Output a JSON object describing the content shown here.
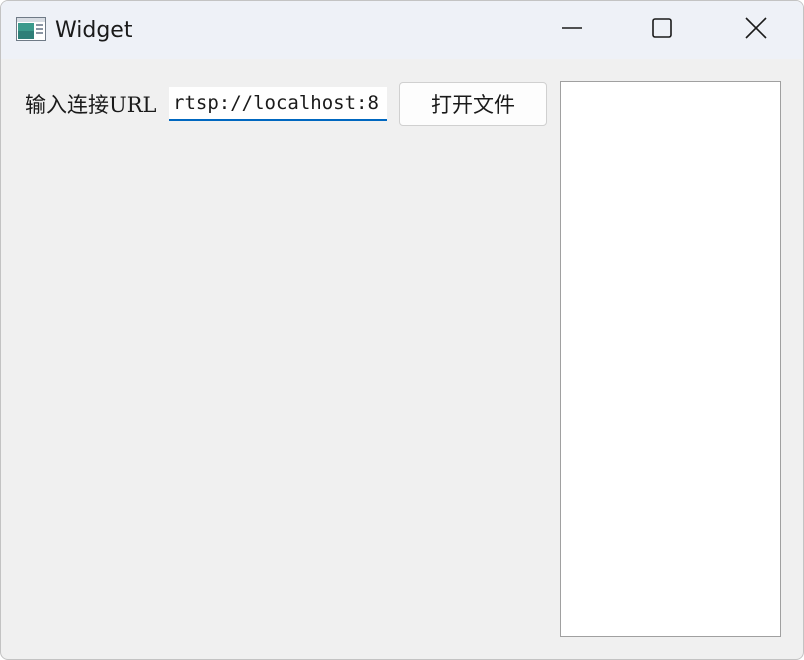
{
  "window": {
    "title": "Widget",
    "icons": {
      "app": "app-window-icon",
      "minimize": "minimize-icon",
      "maximize": "maximize-icon",
      "close": "close-icon"
    }
  },
  "form": {
    "url_label": "输入连接URL",
    "url_value": "rtsp://localhost:8",
    "open_file_label": "打开文件"
  }
}
